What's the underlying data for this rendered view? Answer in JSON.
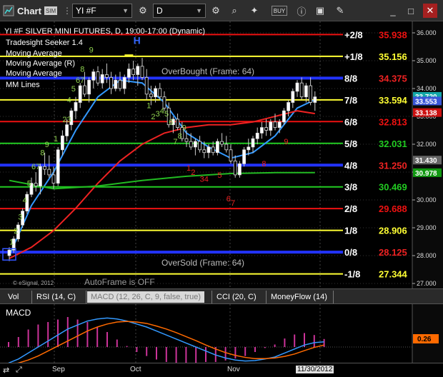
{
  "toolbar": {
    "window_title": "Chart",
    "window_badge": "SIM",
    "symbol": "YI #F",
    "interval": "D"
  },
  "legend": {
    "title": "YI #F SILVER MINI FUTURES, D, 19:00-17:00 (Dynamic)",
    "studies": [
      "Tradesight Seeker 1.4",
      "Moving Average",
      "Moving Average (R)",
      "Moving Average",
      "MM Lines"
    ]
  },
  "overlays": {
    "overbought": "OverBought (Frame: 64)",
    "oversold": "OverSold (Frame: 64)",
    "autoframe": "AutoFrame is OFF",
    "copyright": "© eSignal, 2012"
  },
  "murrey_lines": [
    {
      "label": "+2/8",
      "value": "35.938",
      "price": 35.938,
      "color": "#ee1111"
    },
    {
      "label": "+1/8",
      "value": "35.156",
      "price": 35.156,
      "color": "#ffff33"
    },
    {
      "label": "8/8",
      "value": "34.375",
      "price": 34.375,
      "color": "#2233ff"
    },
    {
      "label": "7/8",
      "value": "33.594",
      "price": 33.594,
      "color": "#ffff33"
    },
    {
      "label": "6/8",
      "value": "32.813",
      "price": 32.813,
      "color": "#ee1111"
    },
    {
      "label": "5/8",
      "value": "32.031",
      "price": 32.031,
      "color": "#22cc22"
    },
    {
      "label": "4/8",
      "value": "31.250",
      "price": 31.25,
      "color": "#2233ff"
    },
    {
      "label": "3/8",
      "value": "30.469",
      "price": 30.469,
      "color": "#22cc22"
    },
    {
      "label": "2/8",
      "value": "29.688",
      "price": 29.688,
      "color": "#ee1111"
    },
    {
      "label": "1/8",
      "value": "28.906",
      "price": 28.906,
      "color": "#ffff33"
    },
    {
      "label": "0/8",
      "value": "28.125",
      "price": 28.125,
      "color": "#2233ff"
    },
    {
      "label": "-1/8",
      "value": "27.344",
      "price": 27.344,
      "color": "#ffff33"
    }
  ],
  "price_axis": {
    "ticks": [
      "36.000",
      "35.000",
      "34.000",
      "33.000",
      "32.000",
      "31.000",
      "30.000",
      "29.000",
      "28.000",
      "27.000"
    ]
  },
  "price_badges": [
    {
      "value": "33.720",
      "price": 33.72,
      "color": "#12a8a8"
    },
    {
      "value": "33.553",
      "price": 33.553,
      "color": "#3a56d8"
    },
    {
      "value": "33.138",
      "price": 33.138,
      "color": "#cc1111"
    },
    {
      "value": "31.430",
      "price": 31.43,
      "color": "#666666"
    },
    {
      "value": "30.978",
      "price": 30.978,
      "color": "#119911"
    }
  ],
  "tabs": [
    {
      "label": "Vol",
      "active": false
    },
    {
      "label": "RSI (14, C)",
      "active": false
    },
    {
      "label": "MACD (12, 26, C, 9, false, true)",
      "active": true
    },
    {
      "label": "CCI (20, C)",
      "active": false
    },
    {
      "label": "MoneyFlow (14)",
      "active": false
    }
  ],
  "macd": {
    "label": "MACD",
    "badge": "0.26"
  },
  "x_axis": {
    "labels": [
      "Sep",
      "Oct",
      "Nov",
      "11/30/2012"
    ]
  },
  "chart_data": {
    "type": "candlestick",
    "title": "YI #F SILVER MINI FUTURES, D, 19:00-17:00 (Dynamic)",
    "ylim": [
      27.0,
      36.3
    ],
    "bars": [
      [
        28.0,
        28.3,
        27.8,
        28.2
      ],
      [
        28.2,
        28.7,
        28.1,
        28.6
      ],
      [
        28.6,
        29.2,
        28.5,
        29.1
      ],
      [
        29.1,
        29.7,
        29.0,
        29.6
      ],
      [
        29.6,
        30.3,
        29.5,
        30.2
      ],
      [
        30.2,
        30.8,
        30.1,
        30.6
      ],
      [
        30.6,
        31.0,
        30.3,
        30.5
      ],
      [
        30.5,
        31.3,
        30.2,
        31.2
      ],
      [
        31.2,
        31.7,
        30.9,
        31.1
      ],
      [
        31.1,
        31.6,
        30.8,
        30.9
      ],
      [
        30.9,
        31.2,
        30.4,
        30.6
      ],
      [
        30.6,
        31.9,
        30.5,
        31.8
      ],
      [
        31.8,
        32.5,
        31.6,
        32.3
      ],
      [
        32.3,
        32.9,
        32.1,
        32.7
      ],
      [
        32.7,
        33.3,
        32.5,
        33.2
      ],
      [
        33.2,
        33.7,
        32.9,
        33.5
      ],
      [
        33.5,
        34.2,
        33.3,
        34.1
      ],
      [
        34.1,
        34.6,
        33.7,
        33.8
      ],
      [
        33.8,
        34.4,
        33.5,
        34.3
      ],
      [
        34.3,
        34.7,
        34.0,
        34.6
      ],
      [
        34.6,
        34.8,
        34.1,
        34.2
      ],
      [
        34.2,
        34.7,
        34.0,
        34.5
      ],
      [
        34.5,
        34.9,
        34.2,
        34.4
      ],
      [
        34.4,
        34.6,
        33.8,
        34.0
      ],
      [
        34.0,
        34.5,
        33.9,
        34.3
      ],
      [
        34.3,
        34.6,
        33.9,
        34.0
      ],
      [
        34.0,
        34.5,
        33.8,
        34.4
      ],
      [
        34.4,
        34.9,
        34.2,
        34.7
      ],
      [
        34.7,
        35.0,
        34.3,
        34.5
      ],
      [
        34.5,
        34.9,
        34.1,
        34.8
      ],
      [
        34.8,
        35.1,
        34.3,
        34.4
      ],
      [
        34.4,
        34.7,
        33.6,
        33.8
      ],
      [
        33.8,
        34.1,
        33.4,
        33.7
      ],
      [
        33.7,
        34.1,
        33.5,
        34.0
      ],
      [
        34.0,
        34.2,
        33.6,
        33.7
      ],
      [
        33.7,
        33.9,
        33.2,
        33.3
      ],
      [
        33.3,
        33.5,
        32.6,
        32.7
      ],
      [
        32.7,
        33.0,
        32.4,
        32.9
      ],
      [
        32.9,
        33.1,
        32.5,
        32.6
      ],
      [
        32.6,
        32.8,
        32.1,
        32.2
      ],
      [
        32.2,
        32.5,
        31.9,
        32.1
      ],
      [
        32.1,
        32.4,
        31.8,
        31.9
      ],
      [
        31.9,
        32.2,
        31.6,
        32.1
      ],
      [
        32.1,
        32.3,
        31.7,
        31.8
      ],
      [
        31.8,
        32.1,
        31.5,
        31.7
      ],
      [
        31.7,
        32.0,
        31.5,
        31.9
      ],
      [
        31.9,
        32.1,
        31.6,
        31.7
      ],
      [
        31.7,
        32.2,
        31.6,
        32.1
      ],
      [
        32.1,
        32.4,
        31.9,
        32.0
      ],
      [
        32.0,
        32.3,
        31.7,
        31.8
      ],
      [
        31.8,
        32.0,
        31.3,
        31.4
      ],
      [
        31.4,
        31.6,
        30.8,
        30.9
      ],
      [
        30.9,
        31.4,
        30.8,
        31.3
      ],
      [
        31.3,
        31.9,
        31.2,
        31.8
      ],
      [
        31.8,
        32.2,
        31.6,
        31.9
      ],
      [
        31.9,
        32.3,
        31.7,
        32.2
      ],
      [
        32.2,
        32.6,
        32.0,
        32.4
      ],
      [
        32.4,
        32.8,
        32.2,
        32.6
      ],
      [
        32.6,
        32.9,
        32.3,
        32.5
      ],
      [
        32.5,
        32.9,
        32.3,
        32.8
      ],
      [
        32.8,
        33.1,
        32.5,
        32.6
      ],
      [
        32.6,
        32.9,
        32.4,
        32.8
      ],
      [
        32.8,
        33.3,
        32.7,
        33.2
      ],
      [
        33.2,
        33.6,
        33.0,
        33.5
      ],
      [
        33.5,
        34.0,
        33.3,
        33.9
      ],
      [
        33.9,
        34.3,
        33.7,
        34.2
      ],
      [
        34.2,
        34.4,
        33.6,
        33.7
      ],
      [
        33.7,
        34.2,
        33.5,
        34.1
      ],
      [
        34.1,
        34.4,
        33.4,
        33.5
      ],
      [
        33.5,
        33.9,
        33.2,
        33.7
      ]
    ],
    "seeker_labels": [
      {
        "text": "1",
        "bar": 0,
        "price": 28.4,
        "color": "#8fd14f"
      },
      {
        "text": "2",
        "bar": 1,
        "price": 28.8,
        "color": "#8fd14f"
      },
      {
        "text": "3",
        "bar": 2,
        "price": 29.3,
        "color": "#8fd14f"
      },
      {
        "text": "4",
        "bar": 3,
        "price": 29.9,
        "color": "#8fd14f"
      },
      {
        "text": "5",
        "bar": 4,
        "price": 30.5,
        "color": "#8fd14f"
      },
      {
        "text": "67",
        "bar": 5,
        "price": 31.1,
        "color": "#8fd14f"
      },
      {
        "text": "8",
        "bar": 7,
        "price": 31.6,
        "color": "#8fd14f"
      },
      {
        "text": "9",
        "bar": 8,
        "price": 31.9,
        "color": "#8fd14f"
      },
      {
        "text": "1",
        "bar": 10,
        "price": 32.1,
        "color": "#8fd14f"
      },
      {
        "text": "23",
        "bar": 12,
        "price": 32.8,
        "color": "#8fd14f"
      },
      {
        "text": "4",
        "bar": 13,
        "price": 33.5,
        "color": "#8fd14f"
      },
      {
        "text": "5",
        "bar": 14,
        "price": 33.9,
        "color": "#8fd14f"
      },
      {
        "text": "67",
        "bar": 15,
        "price": 34.2,
        "color": "#8fd14f"
      },
      {
        "text": "8",
        "bar": 16,
        "price": 34.6,
        "color": "#8fd14f"
      },
      {
        "text": "9",
        "bar": 18,
        "price": 35.3,
        "color": "#8fd14f"
      },
      {
        "text": "1",
        "bar": 31,
        "price": 33.3,
        "color": "#8fd14f"
      },
      {
        "text": "2",
        "bar": 32,
        "price": 32.9,
        "color": "#8fd14f"
      },
      {
        "text": "3",
        "bar": 33,
        "price": 33.0,
        "color": "#8fd14f"
      },
      {
        "text": "4",
        "bar": 34,
        "price": 33.1,
        "color": "#8fd14f"
      },
      {
        "text": "5",
        "bar": 35,
        "price": 33.0,
        "color": "#8fd14f"
      },
      {
        "text": "6",
        "bar": 36,
        "price": 32.7,
        "color": "#8fd14f"
      },
      {
        "text": "7",
        "bar": 37,
        "price": 32.0,
        "color": "#8fd14f"
      },
      {
        "text": "8",
        "bar": 38,
        "price": 32.2,
        "color": "#8fd14f"
      },
      {
        "text": "9",
        "bar": 39,
        "price": 32.5,
        "color": "#8fd14f"
      },
      {
        "text": "1",
        "bar": 40,
        "price": 31.05,
        "color": "#ee2222"
      },
      {
        "text": "2",
        "bar": 41,
        "price": 30.9,
        "color": "#ee2222"
      },
      {
        "text": "34",
        "bar": 43,
        "price": 30.65,
        "color": "#ee2222"
      },
      {
        "text": "5",
        "bar": 47,
        "price": 30.8,
        "color": "#ee2222"
      },
      {
        "text": "6",
        "bar": 49,
        "price": 29.95,
        "color": "#ee2222"
      },
      {
        "text": "7",
        "bar": 50,
        "price": 29.8,
        "color": "#ee2222"
      },
      {
        "text": "8",
        "bar": 57,
        "price": 31.2,
        "color": "#ee2222"
      },
      {
        "text": "9",
        "bar": 62,
        "price": 32.0,
        "color": "#ee2222"
      }
    ],
    "h_marker": {
      "text": "H",
      "bar": 28,
      "price": 35.6
    },
    "moving_averages": [
      {
        "color": "#3399ff",
        "points": [
          [
            0,
            28.0
          ],
          [
            5,
            29.8
          ],
          [
            10,
            31.0
          ],
          [
            15,
            32.5
          ],
          [
            20,
            33.7
          ],
          [
            25,
            34.3
          ],
          [
            30,
            34.2
          ],
          [
            35,
            33.5
          ],
          [
            40,
            32.4
          ],
          [
            45,
            31.9
          ],
          [
            50,
            31.5
          ],
          [
            55,
            31.7
          ],
          [
            60,
            32.3
          ],
          [
            65,
            33.3
          ],
          [
            69,
            33.6
          ]
        ]
      },
      {
        "color": "#ee2222",
        "points": [
          [
            0,
            27.9
          ],
          [
            5,
            28.3
          ],
          [
            10,
            28.9
          ],
          [
            15,
            29.7
          ],
          [
            20,
            30.6
          ],
          [
            25,
            31.4
          ],
          [
            30,
            32.0
          ],
          [
            35,
            32.4
          ],
          [
            40,
            32.6
          ],
          [
            45,
            32.7
          ],
          [
            50,
            32.7
          ],
          [
            55,
            32.8
          ],
          [
            60,
            33.0
          ],
          [
            65,
            33.2
          ],
          [
            69,
            33.1
          ]
        ]
      },
      {
        "color": "#22bb22",
        "points": [
          [
            0,
            30.7
          ],
          [
            10,
            30.4
          ],
          [
            20,
            30.5
          ],
          [
            30,
            30.7
          ],
          [
            40,
            30.85
          ],
          [
            50,
            30.95
          ],
          [
            60,
            30.98
          ],
          [
            69,
            30.98
          ]
        ]
      }
    ],
    "macd_line": [
      -0.8,
      -0.6,
      -0.3,
      0.0,
      0.3,
      0.6,
      0.9,
      1.1,
      1.3,
      1.4,
      1.45,
      1.4,
      1.3,
      1.15,
      1.0,
      0.8,
      0.6,
      0.4,
      0.2,
      0.0,
      -0.2,
      -0.4,
      -0.55,
      -0.65,
      -0.7,
      -0.68,
      -0.6,
      -0.5,
      -0.3,
      -0.1,
      0.1,
      0.22,
      0.26
    ],
    "signal_line": [
      -0.9,
      -0.8,
      -0.65,
      -0.45,
      -0.2,
      0.05,
      0.3,
      0.55,
      0.8,
      1.0,
      1.15,
      1.25,
      1.28,
      1.25,
      1.18,
      1.05,
      0.9,
      0.72,
      0.52,
      0.32,
      0.1,
      -0.1,
      -0.28,
      -0.42,
      -0.52,
      -0.58,
      -0.58,
      -0.55,
      -0.47,
      -0.35,
      -0.18,
      -0.02,
      0.1
    ]
  }
}
